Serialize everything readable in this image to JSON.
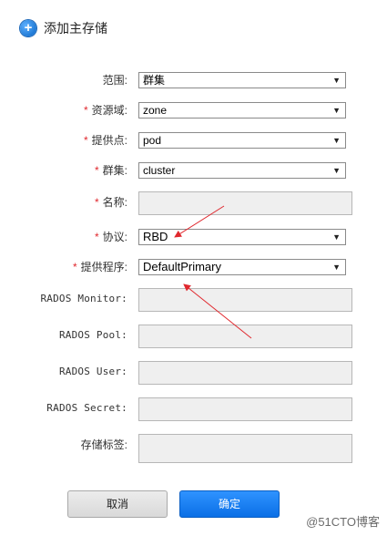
{
  "header": {
    "title": "添加主存储"
  },
  "form": {
    "scope": {
      "label": "范围:",
      "value": "群集"
    },
    "zone": {
      "required": "*",
      "label": "资源域:",
      "value": "zone"
    },
    "pod": {
      "required": "*",
      "label": "提供点:",
      "value": "pod"
    },
    "cluster": {
      "required": "*",
      "label": "群集:",
      "value": "cluster"
    },
    "name": {
      "required": "*",
      "label": "名称:",
      "value": ""
    },
    "protocol": {
      "required": "*",
      "label": "协议:",
      "value": "RBD"
    },
    "provider": {
      "required": "*",
      "label": "提供程序:",
      "value": "DefaultPrimary"
    },
    "rados_monitor": {
      "label": "RADOS Monitor:",
      "value": ""
    },
    "rados_pool": {
      "label": "RADOS Pool:",
      "value": ""
    },
    "rados_user": {
      "label": "RADOS User:",
      "value": ""
    },
    "rados_secret": {
      "label": "RADOS Secret:",
      "value": ""
    },
    "storage_tags": {
      "label": "存储标签:",
      "value": ""
    }
  },
  "buttons": {
    "cancel": "取消",
    "ok": "确定"
  },
  "watermark": "@51CTO博客",
  "icons": {
    "add": "plus-circle-icon",
    "dropdown": "chevron-down-icon"
  },
  "colors": {
    "required": "#e0282e",
    "primary": "#0a6fe6",
    "annotation_arrow": "#e0282e"
  }
}
